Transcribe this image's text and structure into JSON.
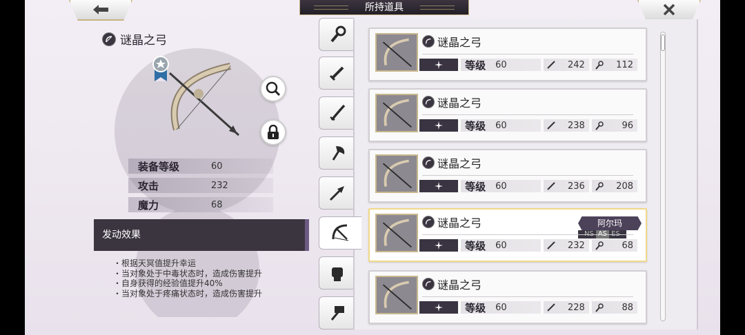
{
  "header": {
    "title": "所持道具"
  },
  "detail": {
    "name": "谜晶之弓",
    "stats": [
      {
        "label": "装备等级",
        "value": "60"
      },
      {
        "label": "攻击",
        "value": "232"
      },
      {
        "label": "魔力",
        "value": "68"
      }
    ],
    "effect_title": "发动效果",
    "effects": [
      "・根据天冥值提升幸运",
      "・当对象处于中毒状态时，造成伤害提升",
      "・自身获得的经验值提升40%",
      "・当对象处于疼痛状态时，造成伤害提升"
    ]
  },
  "categories": [
    "staff",
    "sword",
    "katana",
    "axe",
    "spear",
    "bow",
    "fist",
    "hammer"
  ],
  "active_category": "bow",
  "list": {
    "level_label": "等级",
    "items": [
      {
        "name": "谜晶之弓",
        "level": "60",
        "attack": "242",
        "magic": "112"
      },
      {
        "name": "谜晶之弓",
        "level": "60",
        "attack": "238",
        "magic": "96"
      },
      {
        "name": "谜晶之弓",
        "level": "60",
        "attack": "236",
        "magic": "208"
      },
      {
        "name": "谜晶之弓",
        "level": "60",
        "attack": "232",
        "magic": "68",
        "owner": "阿尔玛",
        "tags": [
          "NS",
          "AS",
          "ES"
        ],
        "active_tag": "AS"
      },
      {
        "name": "谜晶之弓",
        "level": "60",
        "attack": "228",
        "magic": "88"
      }
    ]
  },
  "colors": {
    "accent_gold": "#c9b47f",
    "dark_panel": "#3b3540",
    "selected_border": "#f1d98a"
  }
}
